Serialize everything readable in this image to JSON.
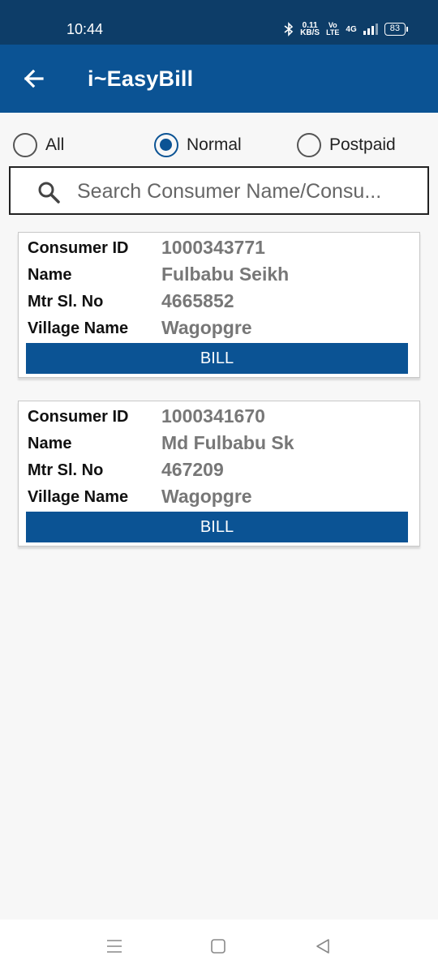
{
  "status_bar": {
    "time": "10:44",
    "speed_value": "0.11",
    "speed_unit": "KB/S",
    "volte_top": "Vo",
    "volte_bottom": "LTE",
    "network": "4G",
    "battery": "83"
  },
  "app_bar": {
    "title": "i~EasyBill",
    "back_icon": "arrow-left-icon"
  },
  "filters": {
    "options": [
      {
        "label": "All",
        "checked": false
      },
      {
        "label": "Normal",
        "checked": true
      },
      {
        "label": "Postpaid",
        "checked": false
      }
    ]
  },
  "search": {
    "placeholder": "Search Consumer Name/Consu...",
    "icon": "search-icon"
  },
  "field_labels": {
    "consumer_id": "Consumer ID",
    "name": "Name",
    "meter": "Mtr Sl. No",
    "village": "Village Name"
  },
  "consumers": [
    {
      "consumer_id": "1000343771",
      "name": "Fulbabu Seikh",
      "meter": "4665852",
      "village": "Wagopgre",
      "button": "BILL"
    },
    {
      "consumer_id": "1000341670",
      "name": "Md Fulbabu Sk",
      "meter": "467209",
      "village": "Wagopgre",
      "button": "BILL"
    }
  ],
  "colors": {
    "status_bar": "#0d3d68",
    "primary": "#0b5394",
    "value_text": "#777777"
  }
}
